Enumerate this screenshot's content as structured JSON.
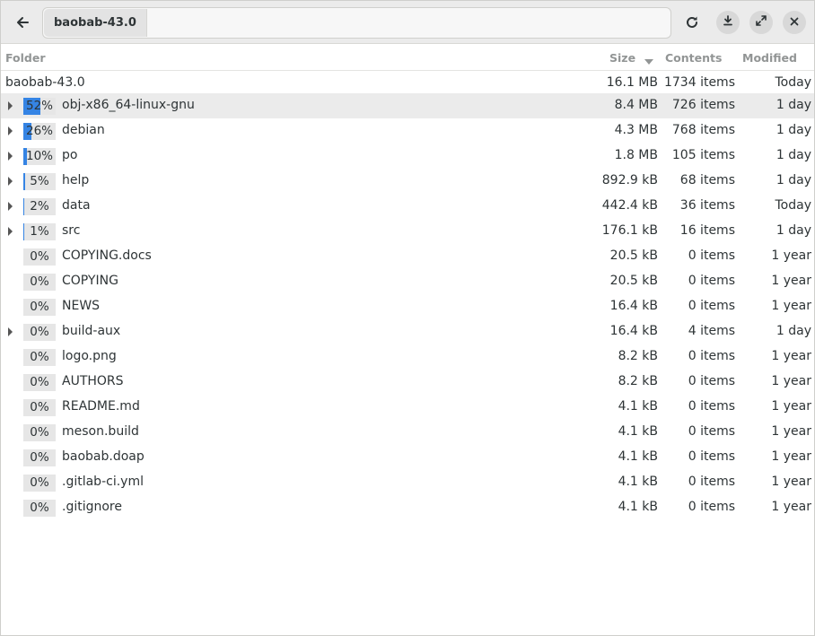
{
  "header": {
    "back_icon": "back-arrow-icon",
    "path_segment": "baobab-43.0",
    "reload_icon": "reload-icon",
    "download_icon": "download-icon",
    "maximize_icon": "maximize-icon",
    "close_icon": "close-icon"
  },
  "columns": {
    "folder": "Folder",
    "size": "Size",
    "contents": "Contents",
    "modified": "Modified"
  },
  "root": {
    "name": "baobab-43.0",
    "size": "16.1 MB",
    "contents": "1734 items",
    "modified": "Today"
  },
  "rows": [
    {
      "pct": "52%",
      "fraction": 0.52,
      "name": "obj-x86_64-linux-gnu",
      "size": "8.4 MB",
      "contents": "726 items",
      "modified": "1 day",
      "expandable": true,
      "selected": true
    },
    {
      "pct": "26%",
      "fraction": 0.26,
      "name": "debian",
      "size": "4.3 MB",
      "contents": "768 items",
      "modified": "1 day",
      "expandable": true
    },
    {
      "pct": "10%",
      "fraction": 0.1,
      "name": "po",
      "size": "1.8 MB",
      "contents": "105 items",
      "modified": "1 day",
      "expandable": true
    },
    {
      "pct": "5%",
      "fraction": 0.05,
      "name": "help",
      "size": "892.9 kB",
      "contents": "68 items",
      "modified": "1 day",
      "expandable": true
    },
    {
      "pct": "2%",
      "fraction": 0.02,
      "name": "data",
      "size": "442.4 kB",
      "contents": "36 items",
      "modified": "Today",
      "expandable": true
    },
    {
      "pct": "1%",
      "fraction": 0.01,
      "name": "src",
      "size": "176.1 kB",
      "contents": "16 items",
      "modified": "1 day",
      "expandable": true
    },
    {
      "pct": "0%",
      "fraction": 0,
      "name": "COPYING.docs",
      "size": "20.5 kB",
      "contents": "0 items",
      "modified": "1 year",
      "expandable": false
    },
    {
      "pct": "0%",
      "fraction": 0,
      "name": "COPYING",
      "size": "20.5 kB",
      "contents": "0 items",
      "modified": "1 year",
      "expandable": false
    },
    {
      "pct": "0%",
      "fraction": 0,
      "name": "NEWS",
      "size": "16.4 kB",
      "contents": "0 items",
      "modified": "1 year",
      "expandable": false
    },
    {
      "pct": "0%",
      "fraction": 0,
      "name": "build-aux",
      "size": "16.4 kB",
      "contents": "4 items",
      "modified": "1 day",
      "expandable": true
    },
    {
      "pct": "0%",
      "fraction": 0,
      "name": "logo.png",
      "size": "8.2 kB",
      "contents": "0 items",
      "modified": "1 year",
      "expandable": false
    },
    {
      "pct": "0%",
      "fraction": 0,
      "name": "AUTHORS",
      "size": "8.2 kB",
      "contents": "0 items",
      "modified": "1 year",
      "expandable": false
    },
    {
      "pct": "0%",
      "fraction": 0,
      "name": "README.md",
      "size": "4.1 kB",
      "contents": "0 items",
      "modified": "1 year",
      "expandable": false
    },
    {
      "pct": "0%",
      "fraction": 0,
      "name": "meson.build",
      "size": "4.1 kB",
      "contents": "0 items",
      "modified": "1 year",
      "expandable": false
    },
    {
      "pct": "0%",
      "fraction": 0,
      "name": "baobab.doap",
      "size": "4.1 kB",
      "contents": "0 items",
      "modified": "1 year",
      "expandable": false
    },
    {
      "pct": "0%",
      "fraction": 0,
      "name": ".gitlab-ci.yml",
      "size": "4.1 kB",
      "contents": "0 items",
      "modified": "1 year",
      "expandable": false
    },
    {
      "pct": "0%",
      "fraction": 0,
      "name": ".gitignore",
      "size": "4.1 kB",
      "contents": "0 items",
      "modified": "1 year",
      "expandable": false
    }
  ],
  "colors": {
    "accent": "#3584e4",
    "selected_row": "#ebebeb"
  }
}
